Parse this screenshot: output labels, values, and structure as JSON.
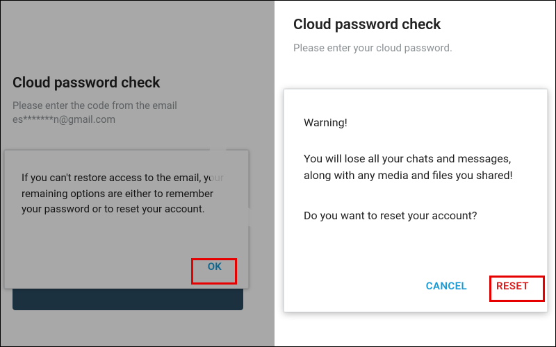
{
  "left": {
    "title": "Cloud password check",
    "subtitle_line1": "Please enter the code from the email",
    "subtitle_line2": "es*******n@gmail.com",
    "dialog": {
      "body": "If you can't restore access to the email, your remaining options are either to remember your password or to reset your account.",
      "ok_label": "OK"
    }
  },
  "right": {
    "title": "Cloud password check",
    "subtitle": "Please enter your cloud password.",
    "dialog": {
      "warning_title": "Warning!",
      "warning_body": "You will lose all your chats and messages, along with any media and files you shared!",
      "question": "Do you want to reset your account?",
      "cancel_label": "CANCEL",
      "reset_label": "RESET"
    }
  }
}
